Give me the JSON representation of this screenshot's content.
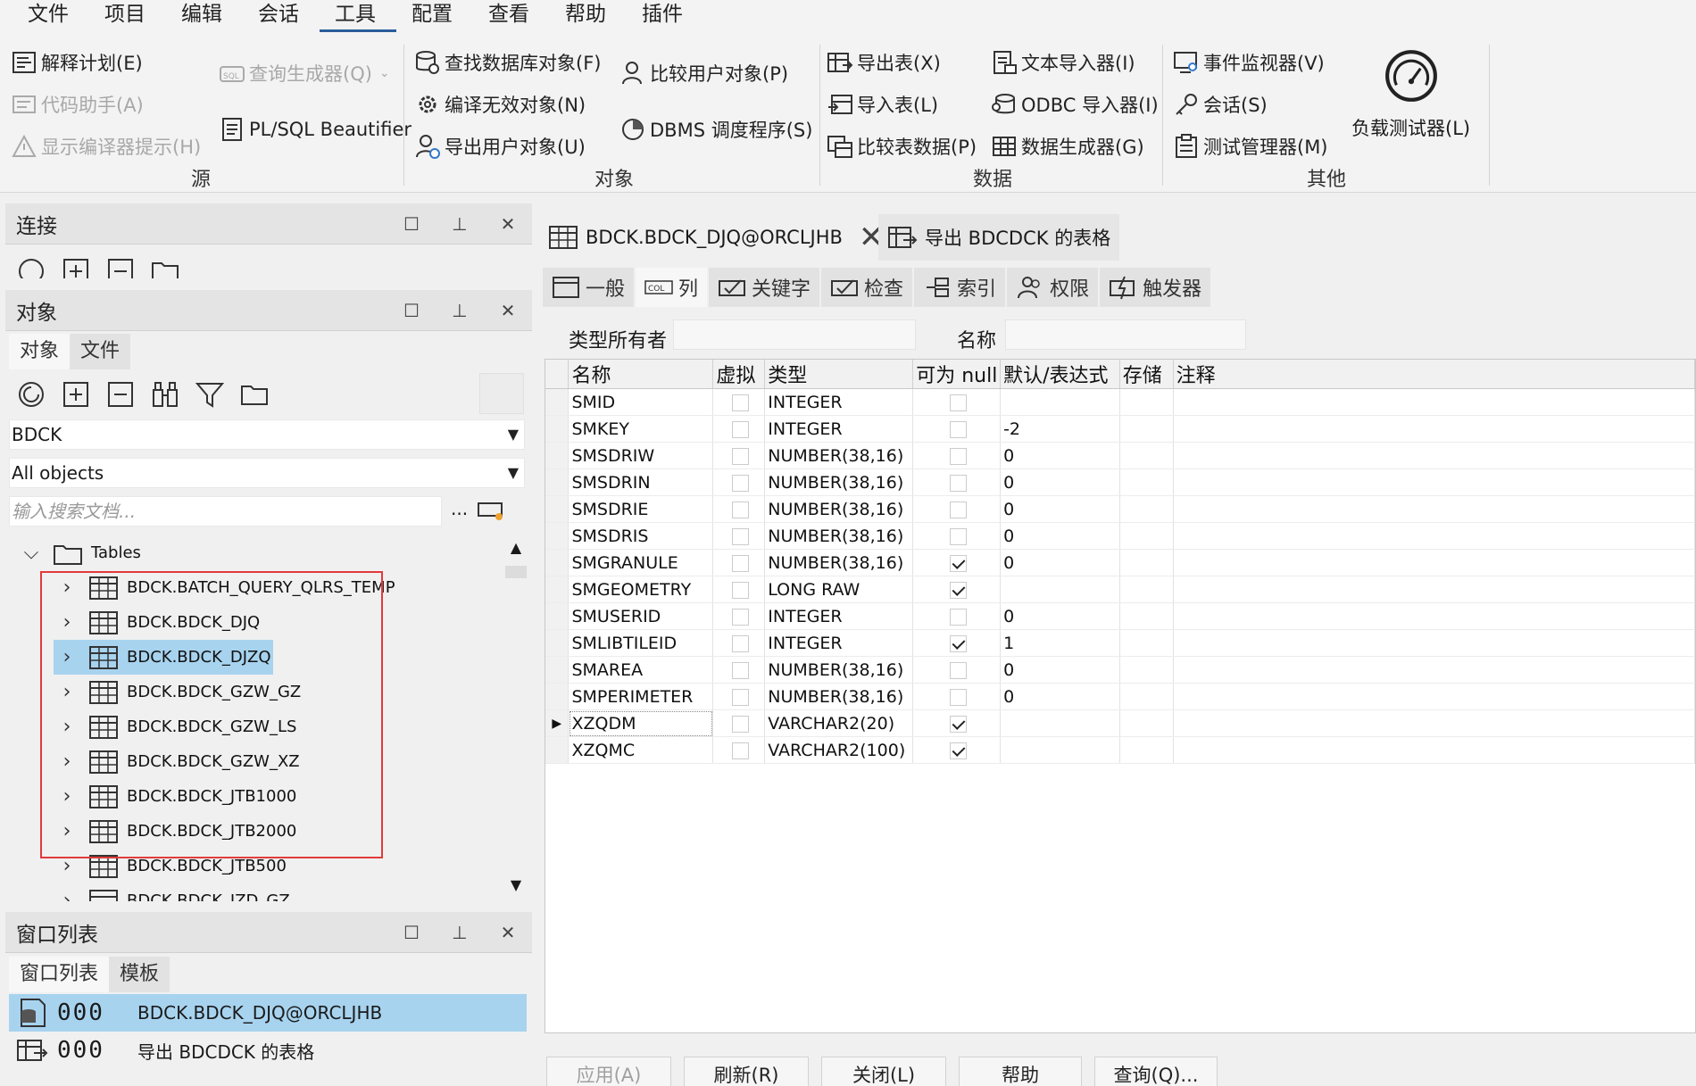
{
  "menu": [
    "文件",
    "项目",
    "编辑",
    "会话",
    "工具",
    "配置",
    "查看",
    "帮助",
    "插件"
  ],
  "ribbon": {
    "source": {
      "label": "源",
      "explain_plan": "解释计划(E)",
      "code_assistant": "代码助手(A)",
      "show_compiler_hints": "显示编译器提示(H)",
      "query_builder": "查询生成器(Q)",
      "beautifier": "PL/SQL Beautifier"
    },
    "objects": {
      "label": "对象",
      "find_db_objects": "查找数据库对象(F)",
      "compile_invalid": "编译无效对象(N)",
      "export_user_objects": "导出用户对象(U)",
      "compare_user_objects": "比较用户对象(P)",
      "dbms_scheduler": "DBMS 调度程序(S)"
    },
    "data": {
      "label": "数据",
      "export_tables": "导出表(X)",
      "import_tables": "导入表(L)",
      "compare_table_data": "比较表数据(P)",
      "text_importer": "文本导入器(I)",
      "odbc_importer": "ODBC 导入器(I)",
      "data_generator": "数据生成器(G)"
    },
    "other": {
      "label": "其他",
      "event_monitor": "事件监视器(V)",
      "sessions": "会话(S)",
      "test_manager": "测试管理器(M)",
      "load_tester": "负载测试器(L)"
    }
  },
  "connections": {
    "title": "连接"
  },
  "objects_panel": {
    "title": "对象",
    "tabs": [
      "对象",
      "文件"
    ],
    "owner": "BDCK",
    "filter": "All objects",
    "search_placeholder": "输入搜索文档...",
    "more": "...",
    "folder": "Tables",
    "items": [
      "BDCK.BATCH_QUERY_QLRS_TEMP",
      "BDCK.BDCK_DJQ",
      "BDCK.BDCK_DJZQ",
      "BDCK.BDCK_GZW_GZ",
      "BDCK.BDCK_GZW_LS",
      "BDCK.BDCK_GZW_XZ",
      "BDCK.BDCK_JTB1000",
      "BDCK.BDCK_JTB2000",
      "BDCK.BDCK_JTB500",
      "BDCK.BDCK_JZD_GZ"
    ]
  },
  "window_list": {
    "title": "窗口列表",
    "tabs": [
      "窗口列表",
      "模板"
    ],
    "items": [
      {
        "count": "000",
        "label": "BDCK.BDCK_DJQ@ORCLJHB"
      },
      {
        "count": "000",
        "label": "导出 BDCDCK 的表格"
      }
    ]
  },
  "doc_tabs": [
    "BDCK.BDCK_DJQ@ORCLJHB",
    "导出 BDCDCK 的表格"
  ],
  "prop_tabs": [
    "一般",
    "列",
    "关键字",
    "检查",
    "索引",
    "权限",
    "触发器"
  ],
  "type_owner_label": "类型所有者",
  "name_label": "名称",
  "columns_header": [
    "名称",
    "虚拟",
    "类型",
    "可为 null",
    "默认/表达式",
    "存储",
    "注释"
  ],
  "columns": [
    {
      "name": "SMID",
      "type": "INTEGER",
      "nullable": false,
      "default": ""
    },
    {
      "name": "SMKEY",
      "type": "INTEGER",
      "nullable": false,
      "default": "-2"
    },
    {
      "name": "SMSDRIW",
      "type": "NUMBER(38,16)",
      "nullable": false,
      "default": "0"
    },
    {
      "name": "SMSDRIN",
      "type": "NUMBER(38,16)",
      "nullable": false,
      "default": "0"
    },
    {
      "name": "SMSDRIE",
      "type": "NUMBER(38,16)",
      "nullable": false,
      "default": "0"
    },
    {
      "name": "SMSDRIS",
      "type": "NUMBER(38,16)",
      "nullable": false,
      "default": "0"
    },
    {
      "name": "SMGRANULE",
      "type": "NUMBER(38,16)",
      "nullable": true,
      "default": "0"
    },
    {
      "name": "SMGEOMETRY",
      "type": "LONG RAW",
      "nullable": true,
      "default": ""
    },
    {
      "name": "SMUSERID",
      "type": "INTEGER",
      "nullable": false,
      "default": "0"
    },
    {
      "name": "SMLIBTILEID",
      "type": "INTEGER",
      "nullable": true,
      "default": "1"
    },
    {
      "name": "SMAREA",
      "type": "NUMBER(38,16)",
      "nullable": false,
      "default": "0"
    },
    {
      "name": "SMPERIMETER",
      "type": "NUMBER(38,16)",
      "nullable": false,
      "default": "0"
    },
    {
      "name": "XZQDM",
      "type": "VARCHAR2(20)",
      "nullable": true,
      "default": ""
    },
    {
      "name": "XZQMC",
      "type": "VARCHAR2(100)",
      "nullable": true,
      "default": ""
    }
  ],
  "bottom_buttons": [
    "应用(A)",
    "刷新(R)",
    "关闭(L)",
    "帮助",
    "查询(Q)..."
  ],
  "colors": {
    "selection": "#a7d3ef",
    "highlight_box": "#e23a3a",
    "accent": "#2a5c9a"
  }
}
